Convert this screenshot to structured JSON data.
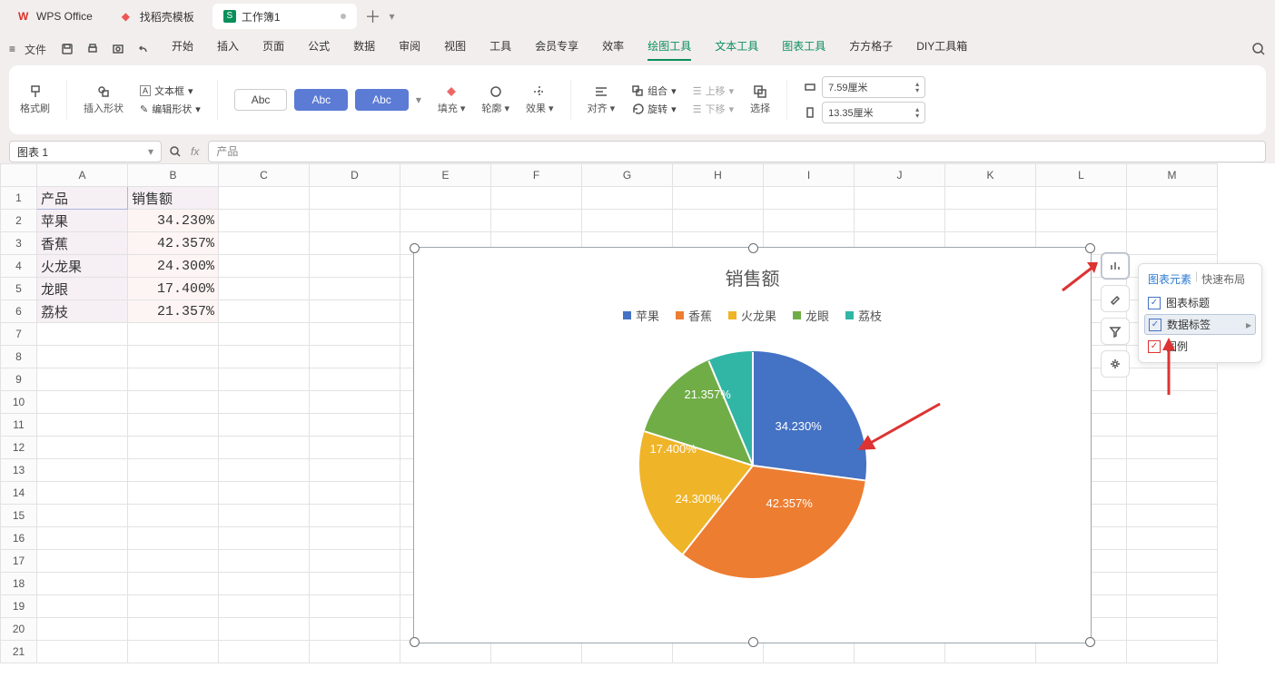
{
  "titlebar": {
    "tabs": [
      {
        "label": "WPS Office",
        "logo": "wps"
      },
      {
        "label": "找稻壳模板",
        "logo": "dk"
      },
      {
        "label": "工作簿1",
        "logo": "s",
        "active": true
      }
    ]
  },
  "menubar": {
    "file": "文件",
    "tabs": [
      "开始",
      "插入",
      "页面",
      "公式",
      "数据",
      "审阅",
      "视图",
      "工具",
      "会员专享",
      "效率",
      "绘图工具",
      "文本工具",
      "图表工具",
      "方方格子",
      "DIY工具箱"
    ]
  },
  "ribbon": {
    "format_brush": "格式刷",
    "insert_shape": "插入形状",
    "textbox": "文本框",
    "edit_shape": "编辑形状",
    "fill": "填充",
    "outline": "轮廓",
    "effect": "效果",
    "align": "对齐",
    "group": "组合",
    "rotate": "旋转",
    "move_up": "上移",
    "move_down": "下移",
    "select": "选择",
    "width": "7.59厘米",
    "height": "13.35厘米",
    "abc": "Abc"
  },
  "formula": {
    "name": "图表 1",
    "fx": "产品"
  },
  "columns": [
    "A",
    "B",
    "C",
    "D",
    "E",
    "F",
    "G",
    "H",
    "I",
    "J",
    "K",
    "L",
    "M"
  ],
  "rows": 21,
  "table": {
    "headers": {
      "a": "产品",
      "b": "销售额"
    },
    "data": [
      {
        "a": "苹果",
        "b": "34.230%"
      },
      {
        "a": "香蕉",
        "b": "42.357%"
      },
      {
        "a": "火龙果",
        "b": "24.300%"
      },
      {
        "a": "龙眼",
        "b": "17.400%"
      },
      {
        "a": "荔枝",
        "b": "21.357%"
      }
    ]
  },
  "chart_data": {
    "type": "pie",
    "title": "销售额",
    "series": [
      {
        "name": "销售额",
        "values": [
          34.23,
          42.357,
          24.3,
          17.4,
          21.357
        ]
      }
    ],
    "categories": [
      "苹果",
      "香蕉",
      "火龙果",
      "龙眼",
      "荔枝"
    ],
    "colors": [
      "#4472c4",
      "#ed7d31",
      "#f0b429",
      "#70ad47",
      "#31b5a5"
    ],
    "labels": [
      "34.230%",
      "42.357%",
      "24.300%",
      "17.400%",
      "21.357%"
    ]
  },
  "popover": {
    "tab1": "图表元素",
    "tab2": "快速布局",
    "item1": "图表标题",
    "item2": "数据标签",
    "item3": "图例"
  }
}
